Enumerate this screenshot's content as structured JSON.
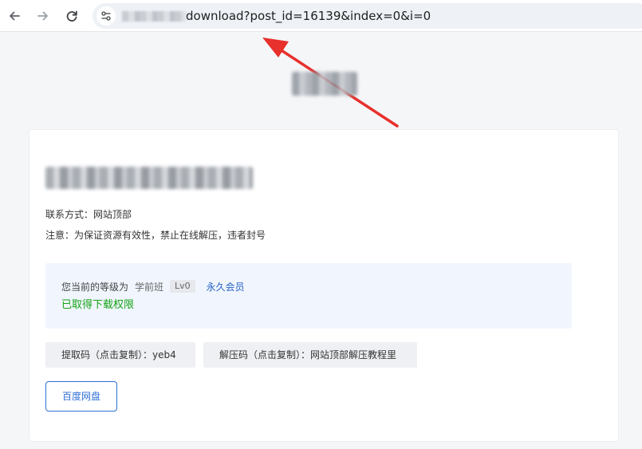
{
  "browser": {
    "url_visible": "download?post_id=16139&index=0&i=0",
    "icons": {
      "back": "arrow-left-icon",
      "forward": "arrow-right-icon",
      "reload": "reload-icon",
      "site_info": "site-settings-icon"
    }
  },
  "card": {
    "contact": "联系方式：网站顶部",
    "notice": "注意：为保证资源有效性，禁止在线解压，违者封号",
    "permission": {
      "label": "您当前的等级为",
      "level": "学前班",
      "level_badge": "Lv0",
      "member": "永久会员",
      "status": "已取得下载权限"
    },
    "extract_code": "提取码（点击复制）：yeb4",
    "unzip_code": "解压码（点击复制）：网站顶部解压教程里",
    "download_button": "百度网盘"
  },
  "colors": {
    "accent": "#2f6fd6",
    "success": "#15a315",
    "annotation": "#e8302c"
  }
}
